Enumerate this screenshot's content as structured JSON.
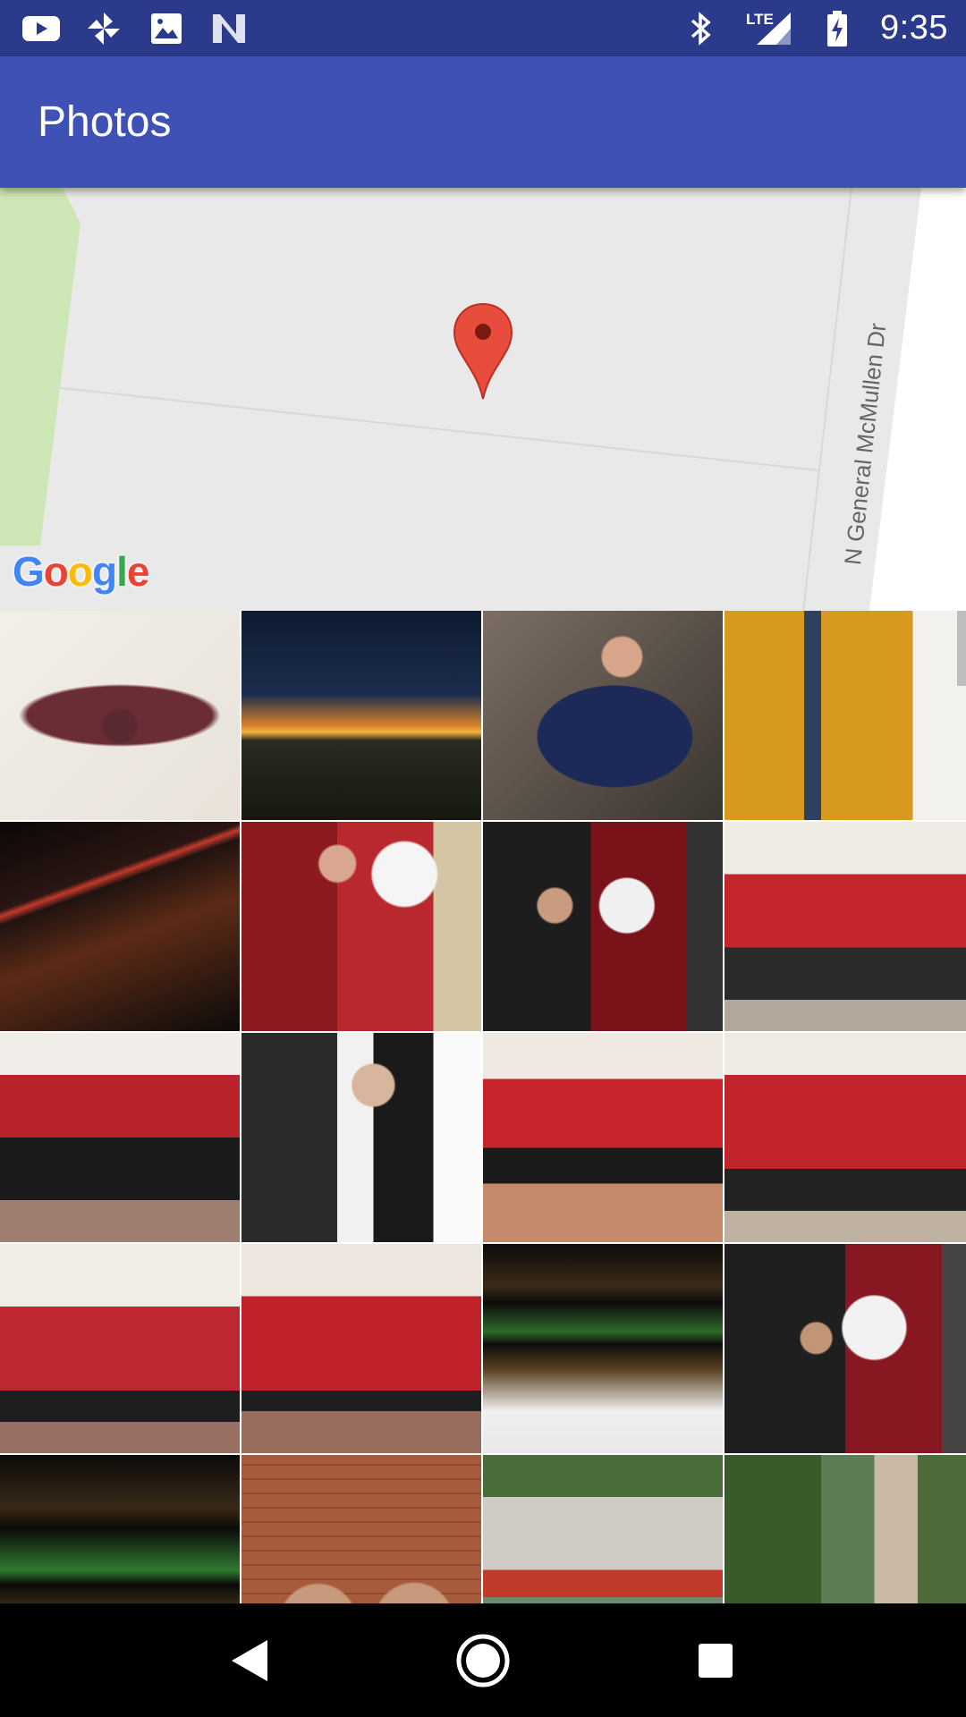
{
  "status_bar": {
    "left_icons": [
      "youtube-icon",
      "pinwheel-icon",
      "image-icon",
      "n-logo-icon"
    ],
    "right_icons": [
      "bluetooth-icon",
      "lte-signal-icon",
      "battery-charging-icon"
    ],
    "lte_label": "LTE",
    "time": "9:35"
  },
  "app_bar": {
    "title": "Photos"
  },
  "map": {
    "road_label": "N General McMullen Dr",
    "marker": "map-pin-icon",
    "logo": {
      "letters": [
        "G",
        "o",
        "o",
        "g",
        "l",
        "e"
      ],
      "colors": [
        "#4285F4",
        "#EA4335",
        "#FBBC05",
        "#4285F4",
        "#34A853",
        "#EA4335"
      ]
    },
    "colors": {
      "background": "#e9e9e9",
      "park": "#cde6b5",
      "road": "#ffffff"
    }
  },
  "photos": [
    {
      "subject": "rosary-bracelet"
    },
    {
      "subject": "sunset-cityscape"
    },
    {
      "subject": "child-superman-shirt"
    },
    {
      "subject": "church-crucifix"
    },
    {
      "subject": "city-night-lights"
    },
    {
      "subject": "woman-with-santa"
    },
    {
      "subject": "man-with-santa"
    },
    {
      "subject": "choir-red-shirts"
    },
    {
      "subject": "choir-at-piano"
    },
    {
      "subject": "pianist"
    },
    {
      "subject": "choir-row"
    },
    {
      "subject": "choir-seated"
    },
    {
      "subject": "choir-crowd"
    },
    {
      "subject": "choir-standing"
    },
    {
      "subject": "theater-balconies"
    },
    {
      "subject": "man-with-santa-2"
    },
    {
      "subject": "theater-balconies-2"
    },
    {
      "subject": "selfie-two-men"
    },
    {
      "subject": "river-bridge-boat"
    },
    {
      "subject": "river-walk"
    }
  ],
  "nav_bar": {
    "icons": [
      "back-icon",
      "home-icon",
      "recents-icon"
    ]
  },
  "colors": {
    "status_bar": "#2c3a8c",
    "app_bar": "#3f51b5",
    "pin": "#e74c3c"
  }
}
